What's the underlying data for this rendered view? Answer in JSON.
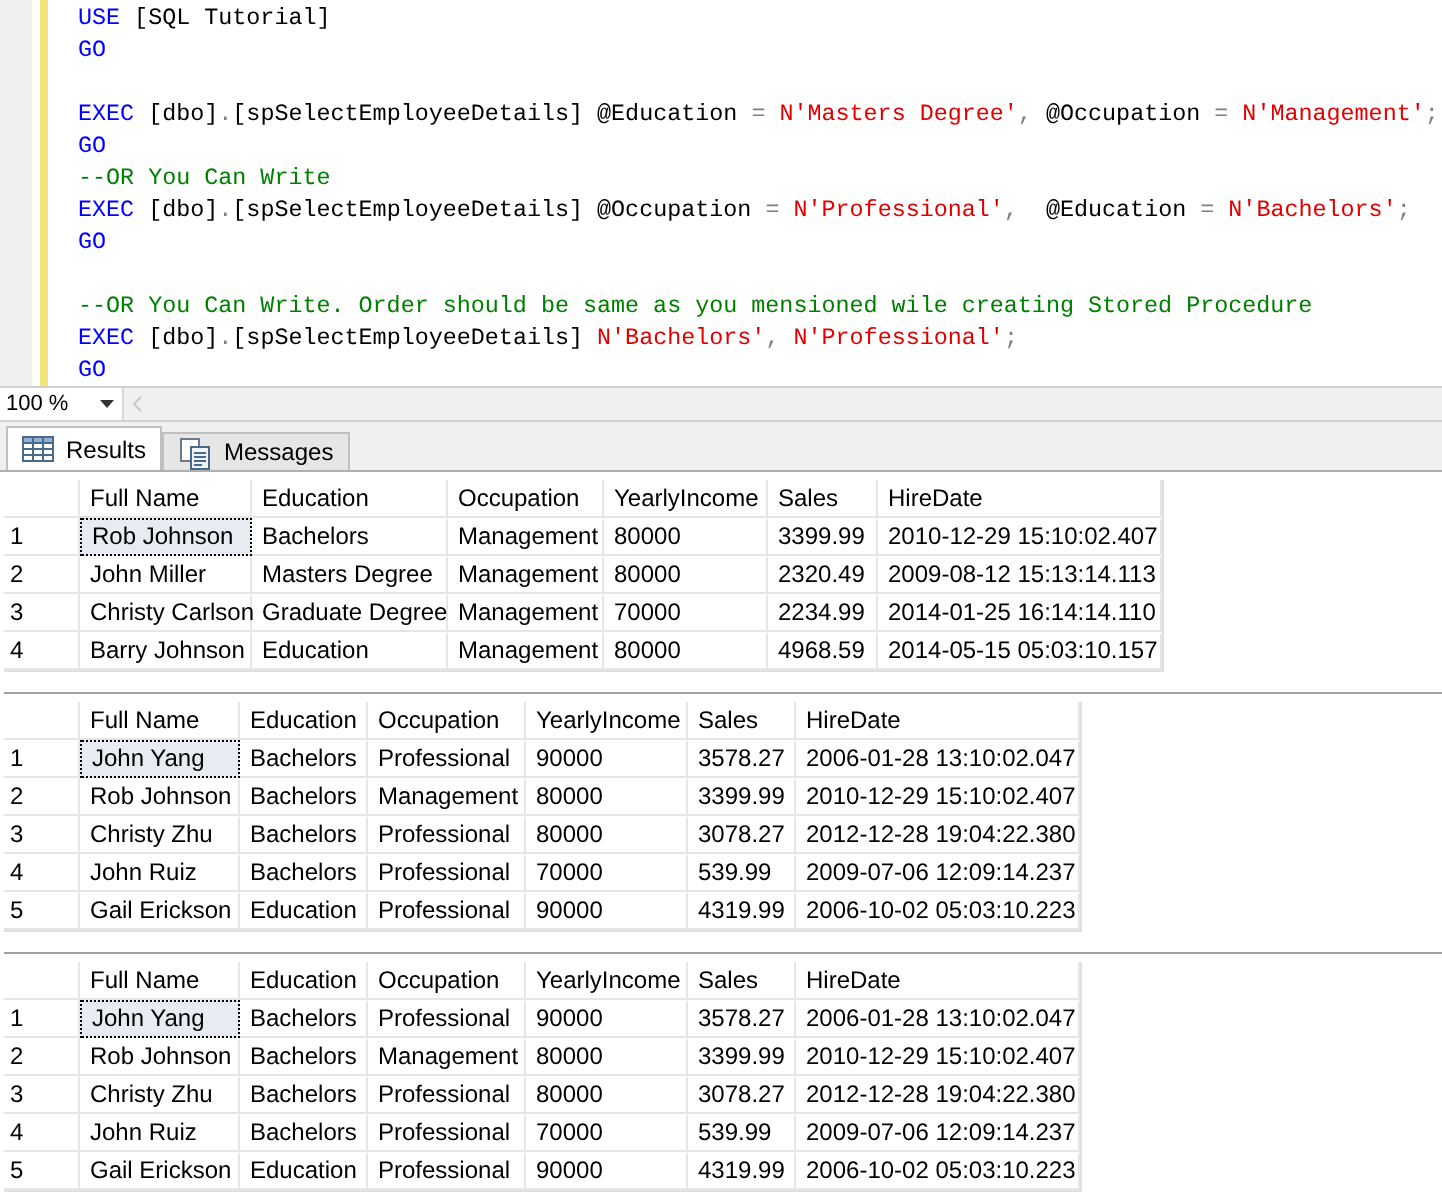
{
  "editor": {
    "blocks": [
      [
        [
          {
            "kind": "keyword",
            "text": "USE"
          },
          {
            "kind": "plain",
            "text": " [SQL Tutorial]"
          }
        ],
        [
          {
            "kind": "keyword",
            "text": "GO"
          }
        ]
      ],
      [
        [
          {
            "kind": "keyword",
            "text": "EXEC"
          },
          {
            "kind": "plain",
            "text": " [dbo]"
          },
          {
            "kind": "operator",
            "text": "."
          },
          {
            "kind": "plain",
            "text": "[spSelectEmployeeDetails] @Education "
          },
          {
            "kind": "operator",
            "text": "="
          },
          {
            "kind": "string",
            "text": " N'Masters Degree'"
          },
          {
            "kind": "operator",
            "text": ","
          },
          {
            "kind": "plain",
            "text": " @Occupation "
          },
          {
            "kind": "operator",
            "text": "="
          },
          {
            "kind": "string",
            "text": " N'Management'"
          },
          {
            "kind": "operator",
            "text": ";"
          }
        ],
        [
          {
            "kind": "keyword",
            "text": "GO"
          }
        ],
        [
          {
            "kind": "comment",
            "text": "--OR You Can Write"
          }
        ],
        [
          {
            "kind": "keyword",
            "text": "EXEC"
          },
          {
            "kind": "plain",
            "text": " [dbo]"
          },
          {
            "kind": "operator",
            "text": "."
          },
          {
            "kind": "plain",
            "text": "[spSelectEmployeeDetails] @Occupation "
          },
          {
            "kind": "operator",
            "text": "="
          },
          {
            "kind": "string",
            "text": " N'Professional'"
          },
          {
            "kind": "operator",
            "text": ","
          },
          {
            "kind": "plain",
            "text": "  @Education "
          },
          {
            "kind": "operator",
            "text": "="
          },
          {
            "kind": "string",
            "text": " N'Bachelors'"
          },
          {
            "kind": "operator",
            "text": ";"
          }
        ],
        [
          {
            "kind": "keyword",
            "text": "GO"
          }
        ]
      ],
      [
        [
          {
            "kind": "comment",
            "text": "--OR You Can Write. Order should be same as you mensioned wile creating Stored Procedure"
          }
        ],
        [
          {
            "kind": "keyword",
            "text": "EXEC"
          },
          {
            "kind": "plain",
            "text": " [dbo]"
          },
          {
            "kind": "operator",
            "text": "."
          },
          {
            "kind": "plain",
            "text": "[spSelectEmployeeDetails] "
          },
          {
            "kind": "string",
            "text": "N'Bachelors'"
          },
          {
            "kind": "operator",
            "text": ","
          },
          {
            "kind": "string",
            "text": " N'Professional'"
          },
          {
            "kind": "operator",
            "text": ";"
          }
        ],
        [
          {
            "kind": "keyword",
            "text": "GO"
          }
        ]
      ]
    ]
  },
  "zoom": {
    "value": "100 %"
  },
  "tabs": [
    {
      "label": "Results",
      "selected": true
    },
    {
      "label": "Messages",
      "selected": false
    }
  ],
  "grids": [
    {
      "columns": [
        "Full Name",
        "Education",
        "Occupation",
        "YearlyIncome",
        "Sales",
        "HireDate"
      ],
      "rows": [
        {
          "number": "1",
          "focused": true,
          "cells": [
            "Rob Johnson",
            "Bachelors",
            "Management",
            "80000",
            "3399.99",
            "2010-12-29 15:10:02.407"
          ]
        },
        {
          "number": "2",
          "focused": false,
          "cells": [
            "John Miller",
            "Masters Degree",
            "Management",
            "80000",
            "2320.49",
            "2009-08-12 15:13:14.113"
          ]
        },
        {
          "number": "3",
          "focused": false,
          "cells": [
            "Christy Carlson",
            "Graduate Degree",
            "Management",
            "70000",
            "2234.99",
            "2014-01-25 16:14:14.110"
          ]
        },
        {
          "number": "4",
          "focused": false,
          "cells": [
            "Barry Johnson",
            "Education",
            "Management",
            "80000",
            "4968.59",
            "2014-05-15 05:03:10.157"
          ]
        }
      ]
    },
    {
      "columns": [
        "Full Name",
        "Education",
        "Occupation",
        "YearlyIncome",
        "Sales",
        "HireDate"
      ],
      "rows": [
        {
          "number": "1",
          "focused": true,
          "cells": [
            "John Yang",
            "Bachelors",
            "Professional",
            "90000",
            "3578.27",
            "2006-01-28 13:10:02.047"
          ]
        },
        {
          "number": "2",
          "focused": false,
          "cells": [
            "Rob Johnson",
            "Bachelors",
            "Management",
            "80000",
            "3399.99",
            "2010-12-29 15:10:02.407"
          ]
        },
        {
          "number": "3",
          "focused": false,
          "cells": [
            "Christy Zhu",
            "Bachelors",
            "Professional",
            "80000",
            "3078.27",
            "2012-12-28 19:04:22.380"
          ]
        },
        {
          "number": "4",
          "focused": false,
          "cells": [
            "John Ruiz",
            "Bachelors",
            "Professional",
            "70000",
            "539.99",
            "2009-07-06 12:09:14.237"
          ]
        },
        {
          "number": "5",
          "focused": false,
          "cells": [
            "Gail Erickson",
            "Education",
            "Professional",
            "90000",
            "4319.99",
            "2006-10-02 05:03:10.223"
          ]
        }
      ]
    },
    {
      "columns": [
        "Full Name",
        "Education",
        "Occupation",
        "YearlyIncome",
        "Sales",
        "HireDate"
      ],
      "rows": [
        {
          "number": "1",
          "focused": true,
          "cells": [
            "John Yang",
            "Bachelors",
            "Professional",
            "90000",
            "3578.27",
            "2006-01-28 13:10:02.047"
          ]
        },
        {
          "number": "2",
          "focused": false,
          "cells": [
            "Rob Johnson",
            "Bachelors",
            "Management",
            "80000",
            "3399.99",
            "2010-12-29 15:10:02.407"
          ]
        },
        {
          "number": "3",
          "focused": false,
          "cells": [
            "Christy Zhu",
            "Bachelors",
            "Professional",
            "80000",
            "3078.27",
            "2012-12-28 19:04:22.380"
          ]
        },
        {
          "number": "4",
          "focused": false,
          "cells": [
            "John Ruiz",
            "Bachelors",
            "Professional",
            "70000",
            "539.99",
            "2009-07-06 12:09:14.237"
          ]
        },
        {
          "number": "5",
          "focused": false,
          "cells": [
            "Gail Erickson",
            "Education",
            "Professional",
            "90000",
            "4319.99",
            "2006-10-02 05:03:10.223"
          ]
        }
      ]
    }
  ]
}
